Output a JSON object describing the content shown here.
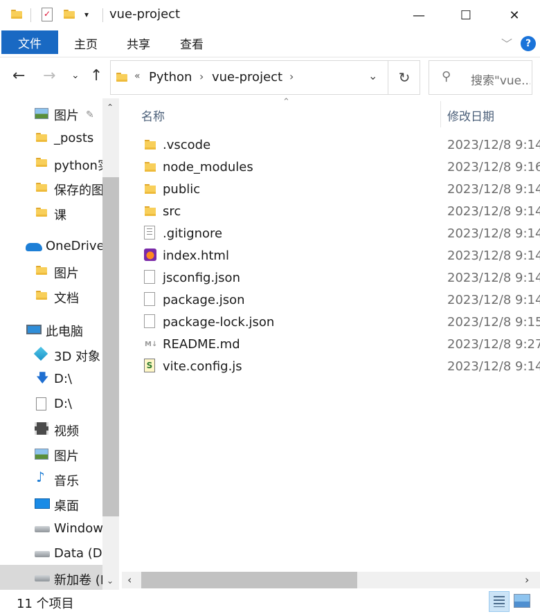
{
  "window": {
    "title": "vue-project",
    "minimize": "—",
    "maximize": "☐",
    "close": "✕"
  },
  "ribbon": {
    "tabs": [
      "文件",
      "主页",
      "共享",
      "查看"
    ],
    "help": "?"
  },
  "address": {
    "overflow": "«",
    "crumbs": [
      "Python",
      "vue-project"
    ],
    "search_placeholder": "搜索\"vue..."
  },
  "sidebar": {
    "items": [
      {
        "label": "图片",
        "icon": "pictures-icon",
        "pinned": true
      },
      {
        "label": "_posts",
        "icon": "folder-icon"
      },
      {
        "label": "python实",
        "icon": "folder-icon"
      },
      {
        "label": "保存的图",
        "icon": "folder-icon"
      },
      {
        "label": "课",
        "icon": "folder-icon"
      },
      {
        "label": "OneDrive",
        "icon": "onedrive-icon"
      },
      {
        "label": "图片",
        "icon": "folder-icon"
      },
      {
        "label": "文档",
        "icon": "folder-icon"
      },
      {
        "label": "此电脑",
        "icon": "this-pc-icon"
      },
      {
        "label": "3D 对象",
        "icon": "3d-objects-icon"
      },
      {
        "label": "D:\\",
        "icon": "downloads-icon"
      },
      {
        "label": "D:\\",
        "icon": "documents-icon"
      },
      {
        "label": "视频",
        "icon": "videos-icon"
      },
      {
        "label": "图片",
        "icon": "pictures-icon"
      },
      {
        "label": "音乐",
        "icon": "music-icon"
      },
      {
        "label": "桌面",
        "icon": "desktop-icon"
      },
      {
        "label": "Windows",
        "icon": "windows-drive-icon"
      },
      {
        "label": "Data (D:",
        "icon": "drive-icon"
      },
      {
        "label": "新加卷 (I",
        "icon": "drive-icon",
        "selected": true
      }
    ]
  },
  "columns": {
    "name": "名称",
    "date": "修改日期"
  },
  "files": [
    {
      "name": ".vscode",
      "date": "2023/12/8 9:14",
      "type": "folder"
    },
    {
      "name": "node_modules",
      "date": "2023/12/8 9:16",
      "type": "folder"
    },
    {
      "name": "public",
      "date": "2023/12/8 9:14",
      "type": "folder"
    },
    {
      "name": "src",
      "date": "2023/12/8 9:14",
      "type": "folder"
    },
    {
      "name": ".gitignore",
      "date": "2023/12/8 9:14",
      "type": "text"
    },
    {
      "name": "index.html",
      "date": "2023/12/8 9:14",
      "type": "html"
    },
    {
      "name": "jsconfig.json",
      "date": "2023/12/8 9:14",
      "type": "file"
    },
    {
      "name": "package.json",
      "date": "2023/12/8 9:14",
      "type": "file"
    },
    {
      "name": "package-lock.json",
      "date": "2023/12/8 9:15",
      "type": "file"
    },
    {
      "name": "README.md",
      "date": "2023/12/8 9:27",
      "type": "md"
    },
    {
      "name": "vite.config.js",
      "date": "2023/12/8 9:14",
      "type": "js"
    }
  ],
  "status": {
    "count_text": "11 个项目"
  },
  "colors": {
    "file_tab": "#1969c3",
    "help": "#1a73d9",
    "header_text": "#4c607a"
  }
}
